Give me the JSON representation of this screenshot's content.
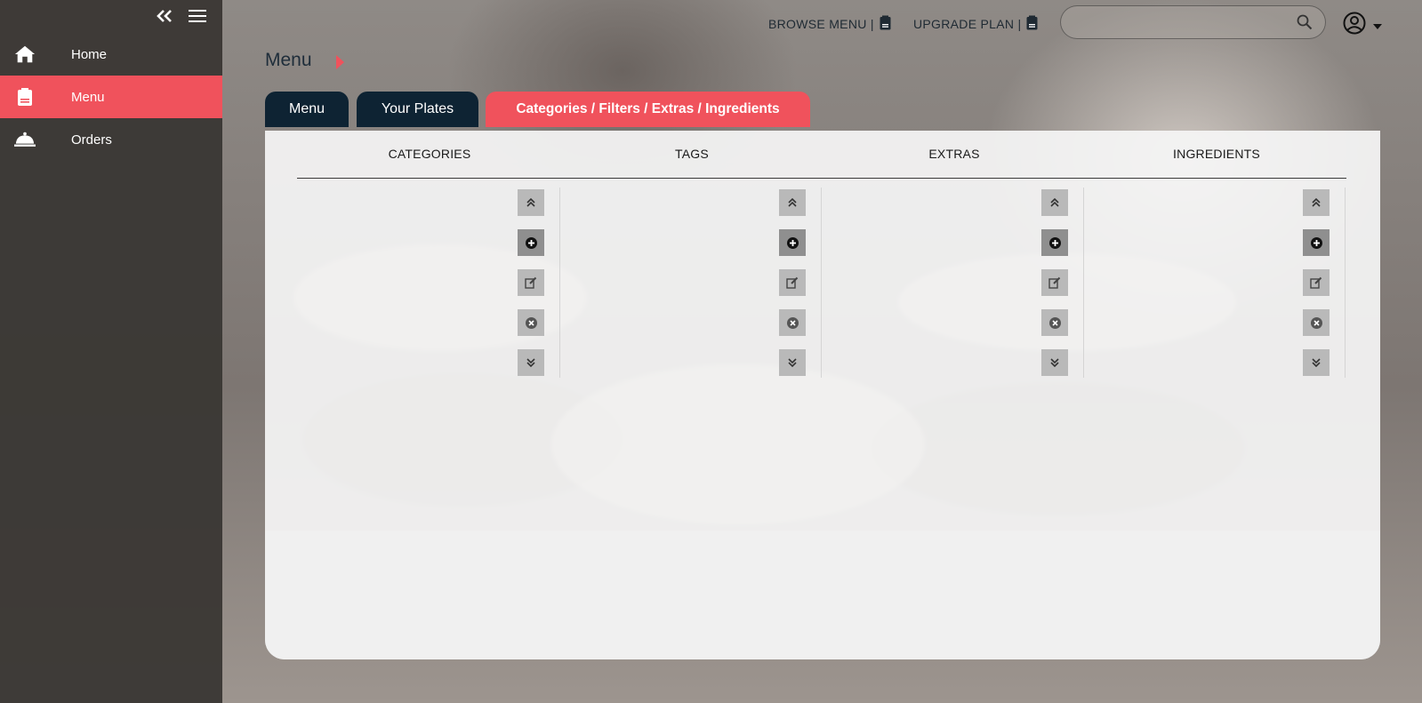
{
  "sidebar": {
    "items": [
      {
        "label": "Home",
        "icon": "home-icon",
        "active": false
      },
      {
        "label": "Menu",
        "icon": "menu-book-icon",
        "active": true
      },
      {
        "label": "Orders",
        "icon": "cloche-icon",
        "active": false
      }
    ]
  },
  "header": {
    "browse_menu": "BROWSE MENU |",
    "upgrade_plan": "UPGRADE PLAN |",
    "search_placeholder": ""
  },
  "breadcrumb": {
    "title": "Menu"
  },
  "tabs": [
    {
      "label": "Menu",
      "active": false
    },
    {
      "label": "Your Plates",
      "active": false
    },
    {
      "label": "Categories / Filters / Extras / Ingredients",
      "active": true
    }
  ],
  "columns": [
    {
      "header": "CATEGORIES"
    },
    {
      "header": "TAGS"
    },
    {
      "header": "EXTRAS"
    },
    {
      "header": "INGREDIENTS"
    }
  ],
  "colors": {
    "accent": "#f0525c",
    "dark_tab": "#0e2333",
    "sidebar": "#3a3734"
  }
}
